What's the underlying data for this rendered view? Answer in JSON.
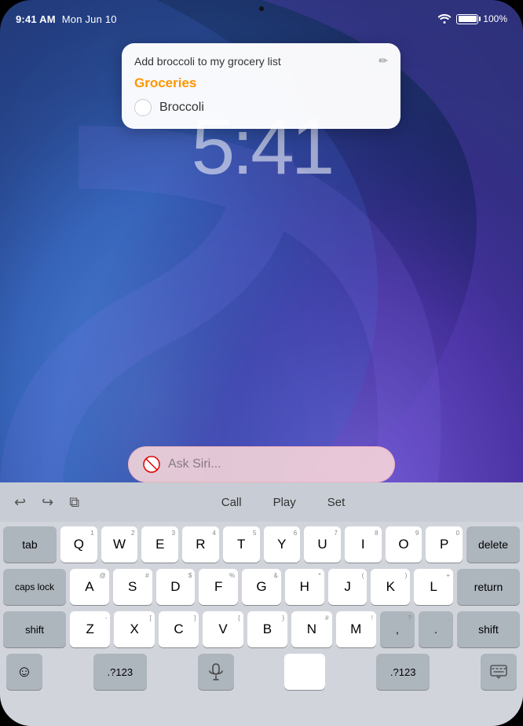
{
  "status_bar": {
    "time": "9:41 AM",
    "date": "Mon Jun 10",
    "battery_percent": "100%",
    "wifi_signal": "wifi"
  },
  "lockscreen": {
    "time": "5:41"
  },
  "notification": {
    "title": "Add broccoli to my grocery list",
    "edit_icon": "✏",
    "list_name": "Groceries",
    "item": "Broccoli"
  },
  "siri": {
    "placeholder": "Ask Siri..."
  },
  "keyboard_toolbar": {
    "undo": "↩",
    "redo": "↪",
    "copy": "⧉",
    "action1": "Call",
    "action2": "Play",
    "action3": "Set"
  },
  "keyboard": {
    "row1": [
      "Q",
      "W",
      "E",
      "R",
      "T",
      "Y",
      "U",
      "I",
      "O",
      "P"
    ],
    "row1_subs": [
      "1",
      "2",
      "3",
      "4",
      "5",
      "6",
      "7",
      "8",
      "9",
      "0"
    ],
    "row2": [
      "A",
      "S",
      "D",
      "F",
      "G",
      "H",
      "J",
      "K",
      "L"
    ],
    "row2_subs": [
      "@",
      "#",
      "$",
      "%",
      "&",
      "*",
      "(",
      ")",
      "+"
    ],
    "row3": [
      "Z",
      "X",
      "C",
      "V",
      "B",
      "N",
      "M"
    ],
    "row3_subs": [
      "-",
      "[",
      "]",
      "{",
      "}",
      "#",
      "!",
      "?"
    ],
    "tab_label": "tab",
    "caps_label": "caps lock",
    "shift_label": "shift",
    "delete_label": "delete",
    "return_label": "return",
    "shift_r_label": "shift",
    "emoji_icon": "☺",
    "num_label": ".?123",
    "mic_icon": "🎙",
    "space_label": "",
    "num_r_label": ".?123",
    "kbd_icon": "⌨"
  }
}
